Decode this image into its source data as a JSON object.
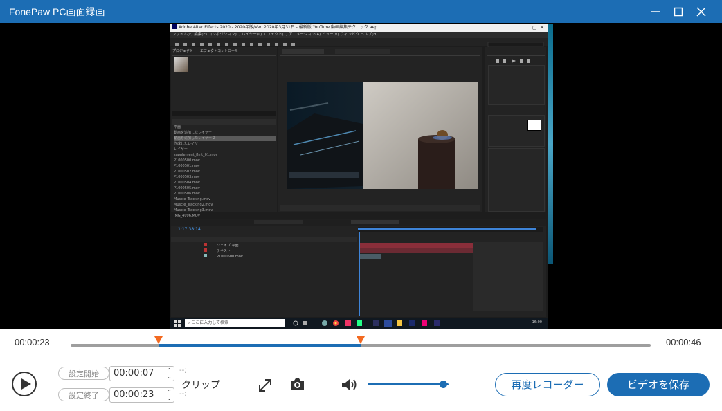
{
  "window": {
    "title": "FonePaw PC画面録画"
  },
  "capture": {
    "ae_title": "Adobe After Effects 2020 - 2020年版/Ver. 2020年3月31日 - 最新版 YouTube 動画編集テクニック.aep",
    "ae_menu": "ファイル(F)  編集(E)  コンポジション(C)  レイヤー(L)  エフェクト(T)  アニメーション(A)  ビュー(V)  ウィンドウ  ヘルプ(H)",
    "project_items": [
      "平面",
      "動画を追加したレイヤー",
      "動画を追加したレイヤー 2",
      "作成したレイヤー",
      "レイヤー",
      "supplement_flmt_01.mov",
      "P1000500.mov",
      "P1000501.mov",
      "P1000502.mov",
      "P1000503.mov",
      "P1000504.mov",
      "P1000505.mov",
      "P1000506.mov",
      "Muscle_Tracking.mov",
      "Muscle_Tracking2.mov",
      "Muscle_Tracking3.mov",
      "IMG_4096.MOV",
      "automatic_film_01.mov"
    ],
    "timecode": "1:17:38:14",
    "layers": [
      "シェイプ 平面",
      "テキスト",
      "P1000500.mov"
    ],
    "taskbar_search": "ここに入力して検索",
    "taskbar_time": "16:00"
  },
  "scrub": {
    "current_time": "00:00:23",
    "total_time": "00:00:46",
    "start_handle": 0.152,
    "end_handle": 0.5
  },
  "controls": {
    "start_label": "設定開始",
    "end_label": "設定終了",
    "start_time": "00:00:07",
    "end_time": "00:00:23",
    "bracket_top": "--;",
    "bracket_bottom": "--;",
    "clip_label": "クリップ",
    "volume": 0.93,
    "rerecord_label": "再度レコーダー",
    "save_label": "ビデオを保存"
  },
  "colors": {
    "brand": "#1c6db4",
    "handle": "#f36a21"
  }
}
